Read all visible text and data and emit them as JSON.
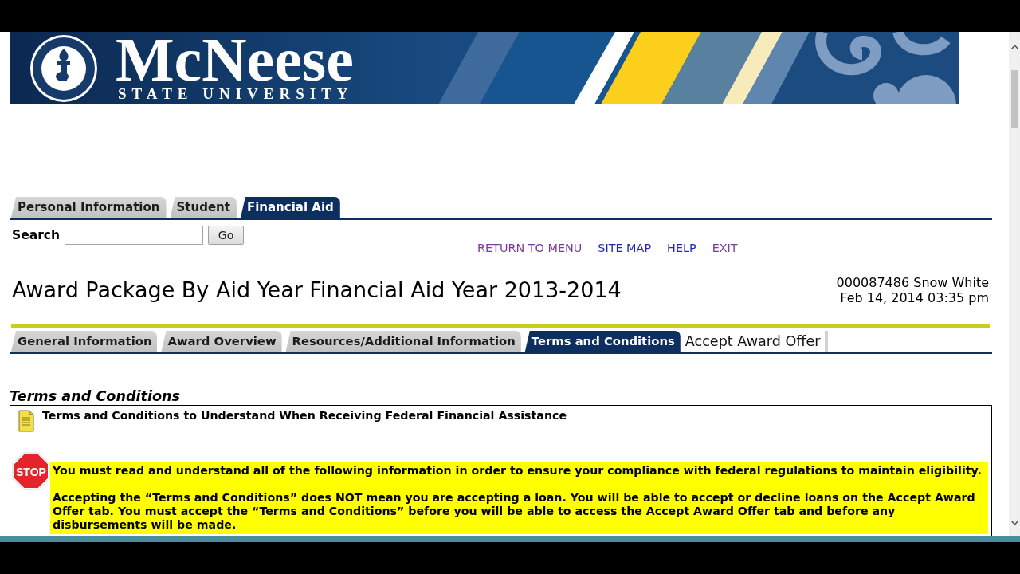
{
  "banner": {
    "wordmark": "McNeese",
    "tagline": "STATE UNIVERSITY"
  },
  "main_tabs": [
    {
      "label": "Personal Information",
      "selected": false
    },
    {
      "label": "Student",
      "selected": false
    },
    {
      "label": "Financial Aid",
      "selected": true
    }
  ],
  "search": {
    "label": "Search",
    "button": "Go"
  },
  "nav_links": [
    {
      "label": "RETURN TO MENU",
      "visited": true
    },
    {
      "label": "SITE MAP",
      "visited": false
    },
    {
      "label": "HELP",
      "visited": false
    },
    {
      "label": "EXIT",
      "visited": true
    }
  ],
  "page_title": "Award Package By Aid Year Financial Aid Year 2013-2014",
  "user_info": {
    "id_name": "000087486 Snow White",
    "timestamp": "Feb 14, 2014 03:35 pm"
  },
  "sub_tabs": [
    {
      "label": "General Information",
      "selected": false,
      "kind": "tab"
    },
    {
      "label": "Award Overview",
      "selected": false,
      "kind": "tab"
    },
    {
      "label": "Resources/Additional Information",
      "selected": false,
      "kind": "tab"
    },
    {
      "label": "Terms and Conditions",
      "selected": true,
      "kind": "tab"
    },
    {
      "label": "Accept Award Offer",
      "selected": false,
      "kind": "plain"
    }
  ],
  "section": {
    "heading": "Terms and Conditions",
    "panel_title": "Terms and Conditions to Understand When Receiving Federal Financial Assistance",
    "stop_sign": "STOP",
    "paragraphs": [
      "You must read and understand all of the following information in order to ensure your compliance with federal regulations to maintain eligibility.",
      "Accepting the “Terms and Conditions” does NOT mean you are accepting a loan. You will be able to accept or decline loans on the Accept Award Offer tab. You must accept the “Terms and Conditions” before you will be able to access the Accept Award Offer tab and before any disbursements will be made."
    ]
  }
}
